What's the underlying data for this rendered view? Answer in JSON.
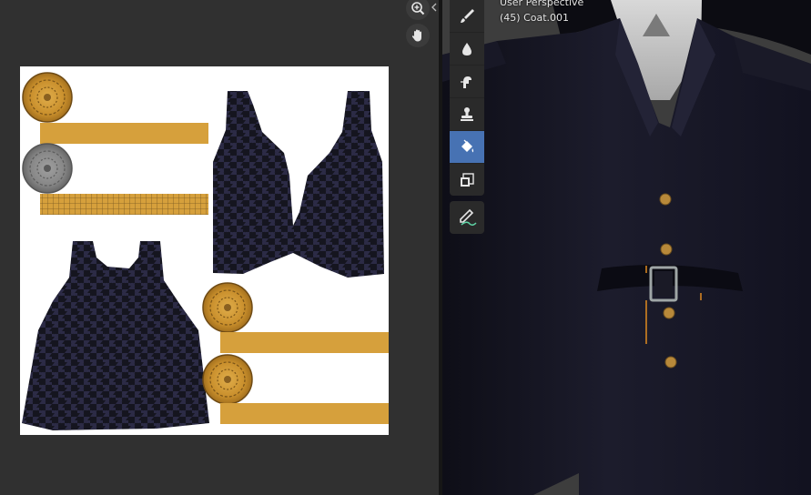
{
  "uv_editor": {
    "navigation": [
      {
        "name": "zoom",
        "icon": "zoom-in-icon"
      },
      {
        "name": "pan",
        "icon": "hand-icon"
      }
    ],
    "collapse_icon": "chevron-left-icon",
    "texture": {
      "fabric_color": "#2c2b46",
      "pattern_color": "#15151f",
      "trim_color": "#d6a03c",
      "button_color": "#d49a30",
      "grey_button_color": "#8a8a8a"
    }
  },
  "viewport": {
    "title": "User Perspective",
    "object": "(45) Coat.001",
    "tools": [
      {
        "name": "draw",
        "icon": "brush-icon",
        "active": false
      },
      {
        "name": "soften",
        "icon": "drop-icon",
        "active": false
      },
      {
        "name": "smear",
        "icon": "smear-icon",
        "active": false
      },
      {
        "name": "clone",
        "icon": "stamp-icon",
        "active": false
      },
      {
        "name": "fill",
        "icon": "bucket-icon",
        "active": true
      },
      {
        "name": "mask",
        "icon": "mask-icon",
        "active": false
      }
    ],
    "annotate_tool": {
      "name": "annotate",
      "icon": "annotate-icon"
    },
    "colors": {
      "background": "#3d3d3d",
      "coat": "#141420",
      "x_axis": "#c0404a",
      "buttons": "#b8893a"
    }
  }
}
